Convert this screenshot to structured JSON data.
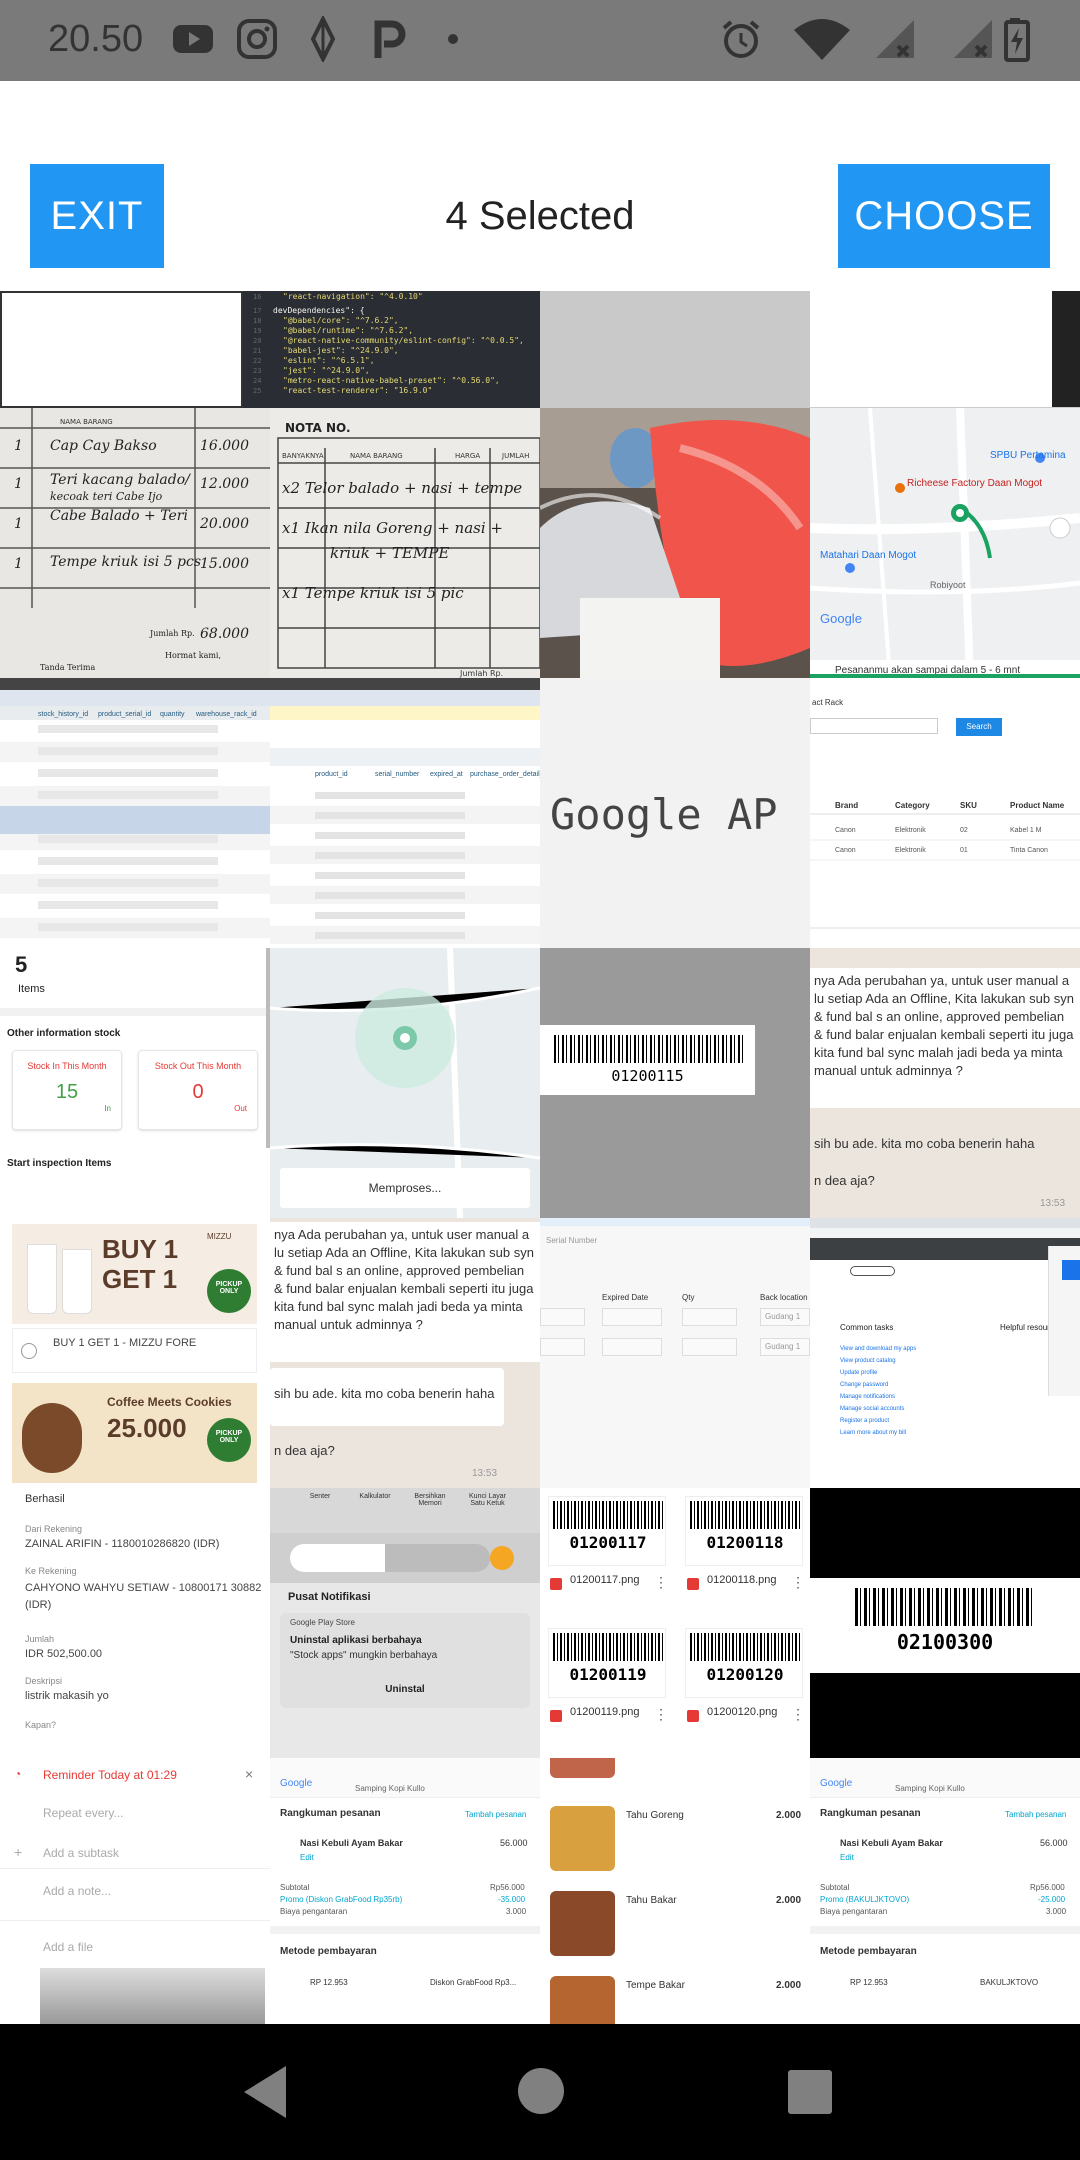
{
  "status_bar": {
    "time": "20.50",
    "icons": [
      "youtube-icon",
      "instagram-icon",
      "app-icon",
      "pocket-icon",
      "dot-icon",
      "alarm-icon",
      "wifi-icon",
      "signal-icon",
      "signal-icon",
      "battery-icon"
    ]
  },
  "header": {
    "exit_label": "EXIT",
    "title": "4 Selected",
    "choose_label": "CHOOSE"
  },
  "thumbs": {
    "nota_header": "NOTA NO.",
    "nota_col1": "BANYAKNYA",
    "nota_col2": "NAMA BARANG",
    "nota_col3": "HARGA",
    "nota_col4": "JUMLAH",
    "map_place1": "Richeese Factory Daan Mogot",
    "map_place2": "SPBU Pertamina",
    "map_place3": "Robiyoot",
    "map_place4": "Matahari Daan Mogot",
    "map_note": "Pesananmu akan sampai dalam 5 - 6 mnt",
    "google": "Google",
    "google_ap": "Google AP",
    "rack_label": "act Rack",
    "search_label": "Search",
    "table_headers": [
      "Brand",
      "Category",
      "SKU",
      "Product Name"
    ],
    "table_row1": [
      "Canon",
      "Elektronik",
      "02",
      "Kabel 1 M"
    ],
    "table_row2": [
      "Canon",
      "Elektronik",
      "01",
      "Tinta Canon"
    ],
    "stock_count": "5",
    "items_label": "Items",
    "other_info": "Other information stock",
    "stock_in_label": "Stock In This Month",
    "stock_in_val": "15",
    "in_label": "In",
    "stock_out_label": "Stock Out This Month",
    "stock_out_val": "0",
    "out_label": "Out",
    "inspection": "Start inspection Items",
    "processing": "Memproses...",
    "barcode_main": "01200115",
    "chat_text": "nya Ada perubahan ya, untuk user manual a lu setiap Ada an Offline, Kita lakukan sub syn & fund bal s an online, approved pembelian & fund balar enjualan kembali seperti itu juga kita fund bal sync malah jadi beda ya minta manual untuk adminnya ?",
    "chat_reply": "sih bu ade. kita mo coba benerin haha",
    "chat_q": "n dea aja?",
    "chat_time": "13:53",
    "promo1_big": "BUY 1 GET 1",
    "promo1_brand": "MIZZU",
    "promo1_caption": "BUY 1 GET 1 - MIZZU FORE",
    "pickup": "PICKUP ONLY",
    "promo2_title": "Coffee Meets Cookies",
    "promo2_price": "25.000",
    "transfer_status": "Berhasil",
    "from_label": "Dari Rekening",
    "from_value": "ZAINAL ARIFIN - 1180010286820 (IDR)",
    "to_label": "Ke Rekening",
    "to_value": "CAHYONO WAHYU SETIAW - 10800171 30882 (IDR)",
    "amount_label": "Jumlah",
    "amount_value": "IDR 502,500.00",
    "desc_label": "Deskripsi",
    "desc_value": "listrik makasih yo",
    "kapan": "Kapan?",
    "notif_title": "Pusat Notifikasi",
    "notif_app": "Google Play Store",
    "notif_msg_title": "Uninstal aplikasi berbahaya",
    "notif_msg_body": "\"Stock apps\" mungkin berbahaya",
    "notif_action": "Uninstal",
    "qs1": "Senter",
    "qs2": "Kalkulator",
    "qs3": "Bersihkan Memori",
    "qs4": "Kunci Layar Satu Ketuk",
    "serial_label": "Serial Number",
    "expired_label": "Expired Date",
    "qty_label": "Qty",
    "back_loc": "Back location",
    "gudang": "Gudang 1",
    "common_tasks": "Common tasks",
    "helpful": "Helpful resources",
    "tasks": [
      "View and download my apps",
      "View product catalog",
      "Update profile",
      "Change password",
      "Manage notifications",
      "Manage social accounts",
      "Register a product",
      "Learn more about my bill"
    ],
    "barcodes": [
      "01200117",
      "01200118",
      "01200119",
      "01200120"
    ],
    "files": [
      "01200117.png",
      "01200118.png",
      "01200119.png",
      "01200120.png"
    ],
    "barcode_big": "02100300",
    "reminder": "Reminder Today at 01:29",
    "repeat": "Repeat every...",
    "subtask": "Add a subtask",
    "note": "Add a note...",
    "add_file": "Add a file",
    "order_summary": "Rangkuman pesanan",
    "add_order": "Tambah pesanan",
    "menu_item": "Nasi Kebuli Ayam Bakar",
    "menu_edit": "Edit",
    "menu_price": "56.000",
    "subtotal": "Subtotal",
    "subtotal_val": "Rp56.000",
    "promo_line": "Promo (Diskon GrabFood Rp35rb)",
    "promo_line2": "Promo (BAKULJKTOVO)",
    "promo_val": "-35.000",
    "promo_val2": "-25.000",
    "delivery": "Biaya pengantaran",
    "delivery_val": "3.000",
    "payment": "Metode pembayaran",
    "pay_amount": "RP 12.953",
    "discount_tag": "Diskon GrabFood Rp3...",
    "discount_tag2": "BAKULJKTOVO",
    "place": "Samping Kopi Kullo",
    "food1": "Tahu Goreng",
    "food2": "Tahu Bakar",
    "food3": "Tempe Bakar",
    "food_price": "2.000"
  },
  "nav": {
    "icons": [
      "back-icon",
      "home-icon",
      "recents-icon"
    ]
  },
  "colors": {
    "accent": "#2196f3",
    "status_bar": "#7a7a7a",
    "nav_bar": "#000000"
  }
}
